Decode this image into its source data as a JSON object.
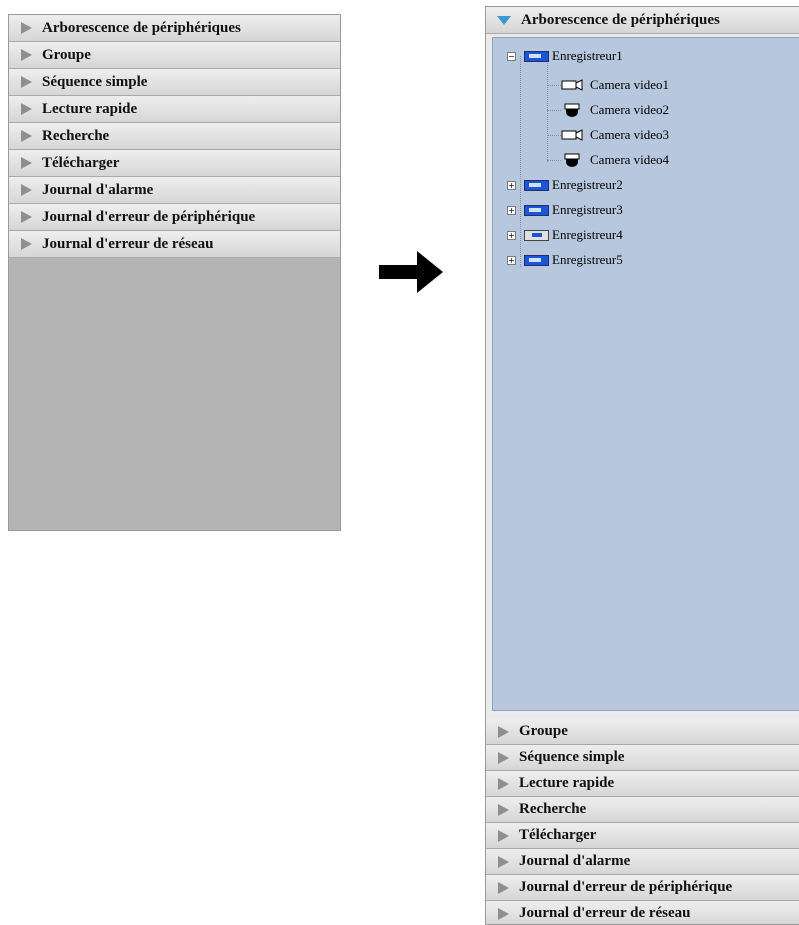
{
  "left_panel": {
    "items": [
      {
        "label": "Arborescence de périphériques"
      },
      {
        "label": "Groupe"
      },
      {
        "label": "Séquence simple"
      },
      {
        "label": "Lecture rapide"
      },
      {
        "label": "Recherche"
      },
      {
        "label": "Télécharger"
      },
      {
        "label": "Journal d'alarme"
      },
      {
        "label": "Journal d'erreur de périphérique"
      },
      {
        "label": "Journal d'erreur de réseau"
      }
    ]
  },
  "right_panel": {
    "expanded_header": "Arborescence de périphériques",
    "tree": {
      "recorders": [
        {
          "label": "Enregistreur1",
          "expanded": true,
          "expander": "−",
          "cameras": [
            {
              "label": "Camera video1",
              "icon": "box-camera-icon"
            },
            {
              "label": "Camera video2",
              "icon": "dome-camera-icon"
            },
            {
              "label": "Camera video3",
              "icon": "box-camera-icon"
            },
            {
              "label": "Camera video4",
              "icon": "dome-camera-icon"
            }
          ]
        },
        {
          "label": "Enregistreur2",
          "expanded": false,
          "expander": "+"
        },
        {
          "label": "Enregistreur3",
          "expanded": false,
          "expander": "+"
        },
        {
          "label": "Enregistreur4",
          "expanded": false,
          "expander": "+"
        },
        {
          "label": "Enregistreur5",
          "expanded": false,
          "expander": "+"
        }
      ]
    },
    "collapsed_headers": [
      {
        "label": "Groupe"
      },
      {
        "label": "Séquence simple"
      },
      {
        "label": "Lecture rapide"
      },
      {
        "label": "Recherche"
      },
      {
        "label": "Télécharger"
      },
      {
        "label": "Journal d'alarme"
      },
      {
        "label": "Journal d'erreur de périphérique"
      },
      {
        "label": "Journal d'erreur de réseau"
      }
    ]
  },
  "colors": {
    "header_bg": "#e2e2e2",
    "empty_panel_bg": "#b4b4b4",
    "tree_bg": "#b7c7dd",
    "expand_indicator": "#3b97d6",
    "recorder_icon": "#1956d8"
  }
}
